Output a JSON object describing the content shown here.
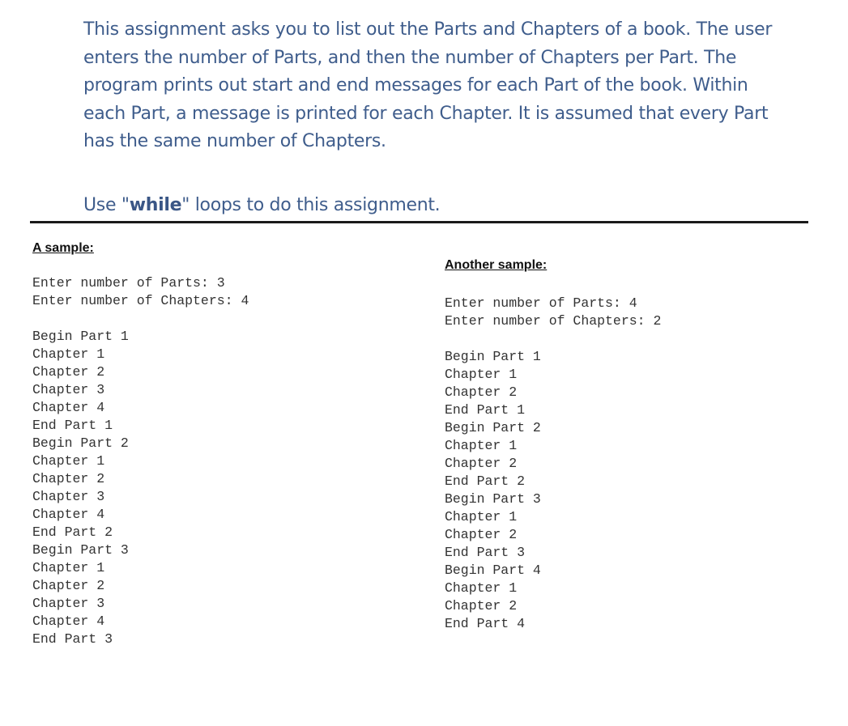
{
  "intro": {
    "lines": [
      "This assignment asks you to list out the Parts and Chapters of a book.  The user",
      "enters the number of Parts, and then the number of Chapters per Part.  The",
      "program prints out start and end messages for each Part of the book.  Within",
      "each Part, a message is printed for each Chapter.  It is assumed that every Part",
      "has the same number of Chapters."
    ]
  },
  "instruction": {
    "prefix": "Use \"",
    "keyword": "while",
    "suffix": "\" loops to do this assignment."
  },
  "samples": [
    {
      "heading": "A sample:",
      "inputs": [
        "Enter number of Parts: 3",
        "Enter number of Chapters: 4"
      ],
      "output": [
        "Begin Part 1",
        "Chapter 1",
        "Chapter 2",
        "Chapter 3",
        "Chapter 4",
        "End Part 1",
        "Begin Part 2",
        "Chapter 1",
        "Chapter 2",
        "Chapter 3",
        "Chapter 4",
        "End Part 2",
        "Begin Part 3",
        "Chapter 1",
        "Chapter 2",
        "Chapter 3",
        "Chapter 4",
        "End Part 3"
      ]
    },
    {
      "heading": "Another sample:",
      "inputs": [
        "Enter number of Parts: 4",
        "Enter number of Chapters: 2"
      ],
      "output": [
        "Begin Part 1",
        "Chapter 1",
        "Chapter 2",
        "End Part 1",
        "Begin Part 2",
        "Chapter 1",
        "Chapter 2",
        "End Part 2",
        "Begin Part 3",
        "Chapter 1",
        "Chapter 2",
        "End Part 3",
        "Begin Part 4",
        "Chapter 1",
        "Chapter 2",
        "End Part 4"
      ]
    }
  ],
  "colors": {
    "prose": "#3f5d8c",
    "console_text": "#333333",
    "rule": "#1a1a1a"
  }
}
